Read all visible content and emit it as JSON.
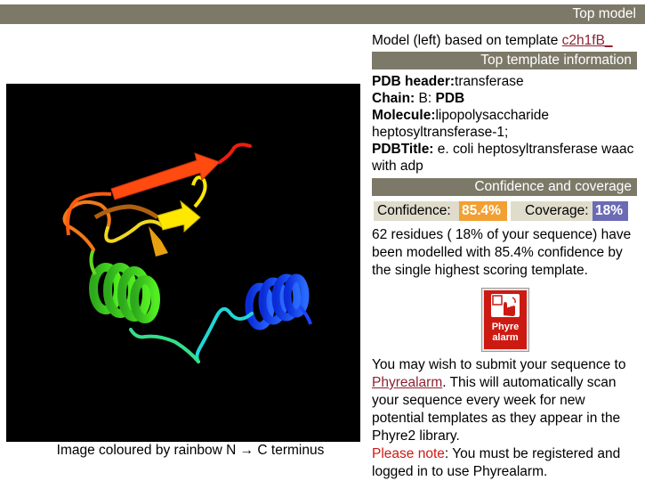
{
  "header": {
    "title": "Top model"
  },
  "model": {
    "prefix": "Model (left) based on template ",
    "template_link": "c2h1fB_"
  },
  "image": {
    "caption": "Image coloured by rainbow N → C terminus"
  },
  "top_template": {
    "heading": "Top template information",
    "pdb_header_label": "PDB header:",
    "pdb_header_value": "transferase",
    "chain_label": "Chain:",
    "chain_value": " B: ",
    "chain_pdb": "PDB",
    "molecule_label": "Molecule:",
    "molecule_value": "lipopolysaccharide heptosyltransferase-1;",
    "pdbtitle_label": "PDBTitle:",
    "pdbtitle_value": " e. coli heptosyltransferase waac with adp"
  },
  "confidence": {
    "heading": "Confidence and coverage",
    "confidence_label": "Confidence:",
    "confidence_value": "85.4%",
    "coverage_label": "Coverage:",
    "coverage_value": "18%",
    "description": "62 residues ( 18% of your sequence) have been modelled with 85.4% confidence by the single highest scoring template."
  },
  "phyrealarm": {
    "icon_text_line1": "Phyre",
    "icon_text_line2": "alarm",
    "text_before": "You may wish to submit your sequence to ",
    "link": "Phyrealarm",
    "text_after": ". This will automatically scan your sequence every week for new potential templates as they appear in the Phyre2 library.",
    "note_label": "Please note",
    "note_text": ": You must be registered and logged in to use Phyrealarm."
  },
  "colors": {
    "bar": "#7d7968",
    "confidence": "#f2a033",
    "coverage": "#6b6bb5",
    "link": "#8b2332",
    "note": "#cc1a12"
  }
}
